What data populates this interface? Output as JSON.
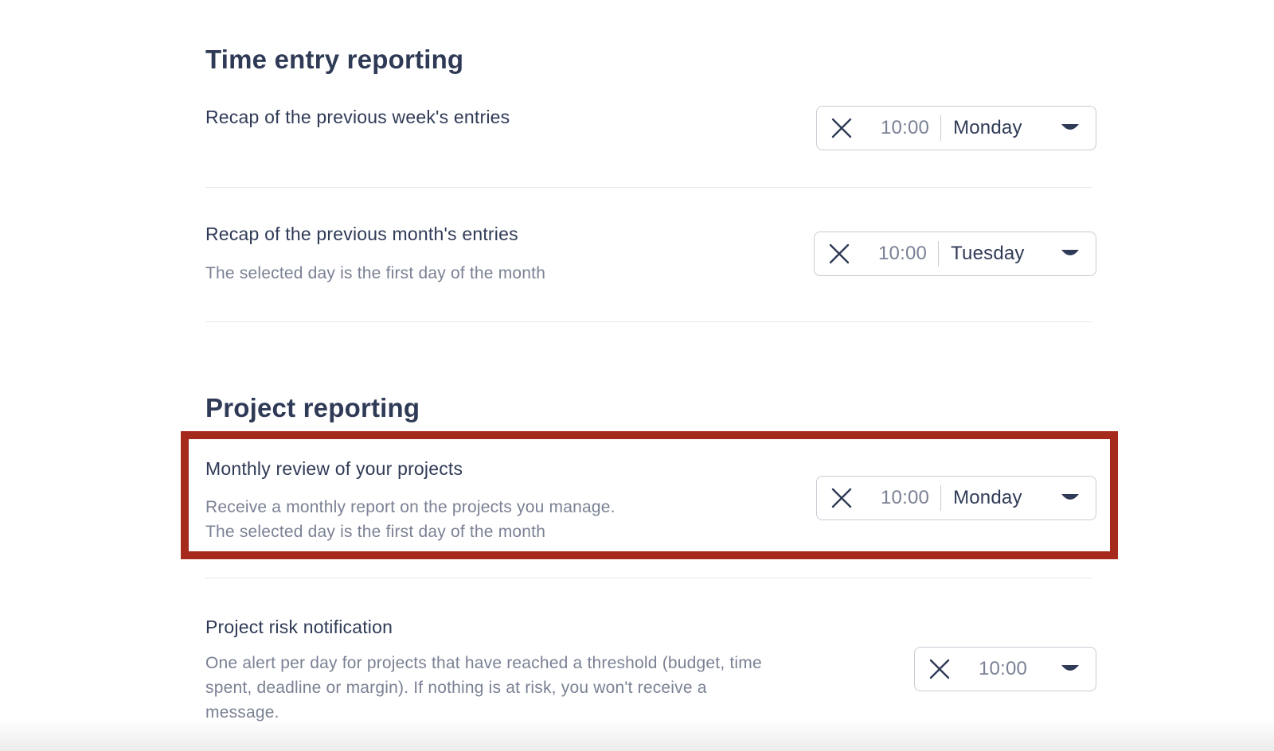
{
  "sections": [
    {
      "title": "Time entry reporting",
      "settings": [
        {
          "title": "Recap of the previous week's entries",
          "description": [],
          "time": "10:00",
          "day": "Monday"
        },
        {
          "title": "Recap of the previous month's entries",
          "description": [
            "The selected day is the first day of the month"
          ],
          "time": "10:00",
          "day": "Tuesday"
        }
      ]
    },
    {
      "title": "Project reporting",
      "settings": [
        {
          "title": "Monthly review of your projects",
          "description": [
            "Receive a monthly report on the projects you manage.",
            "The selected day is the first day of the month"
          ],
          "time": "10:00",
          "day": "Monday"
        },
        {
          "title": "Project risk notification",
          "description": [
            "One alert per day for projects that have reached a threshold (budget, time",
            "spent, deadline or margin). If nothing is at risk, you won't receive a",
            "message."
          ],
          "time": "10:00"
        }
      ]
    }
  ],
  "icons": {
    "clear": "close-icon",
    "dropdown": "caret-down-icon"
  },
  "colors": {
    "heading": "#2f3a56",
    "muted": "#7a8194",
    "border": "#c9ccd4",
    "highlight": "#a52a1c"
  }
}
